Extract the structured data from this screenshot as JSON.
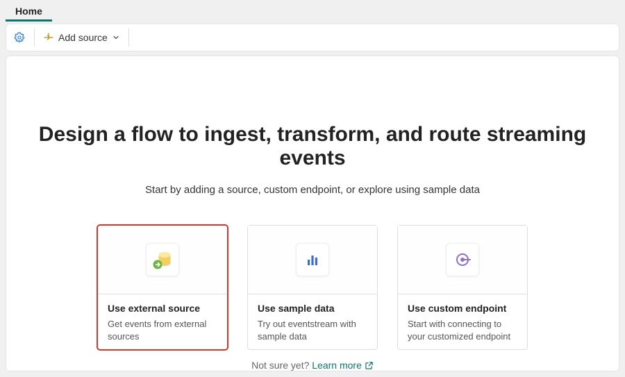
{
  "tabs": {
    "home": "Home"
  },
  "toolbar": {
    "add_source_label": "Add source"
  },
  "main": {
    "title": "Design a flow to ingest, transform, and route streaming events",
    "subtitle": "Start by adding a source, custom endpoint, or explore using sample data"
  },
  "cards": [
    {
      "title": "Use external source",
      "desc": "Get events from external sources",
      "highlighted": true
    },
    {
      "title": "Use sample data",
      "desc": "Try out eventstream with sample data",
      "highlighted": false
    },
    {
      "title": "Use custom endpoint",
      "desc": "Start with connecting to your customized endpoint",
      "highlighted": false
    }
  ],
  "footer": {
    "prompt": "Not sure yet?",
    "link": "Learn more"
  }
}
